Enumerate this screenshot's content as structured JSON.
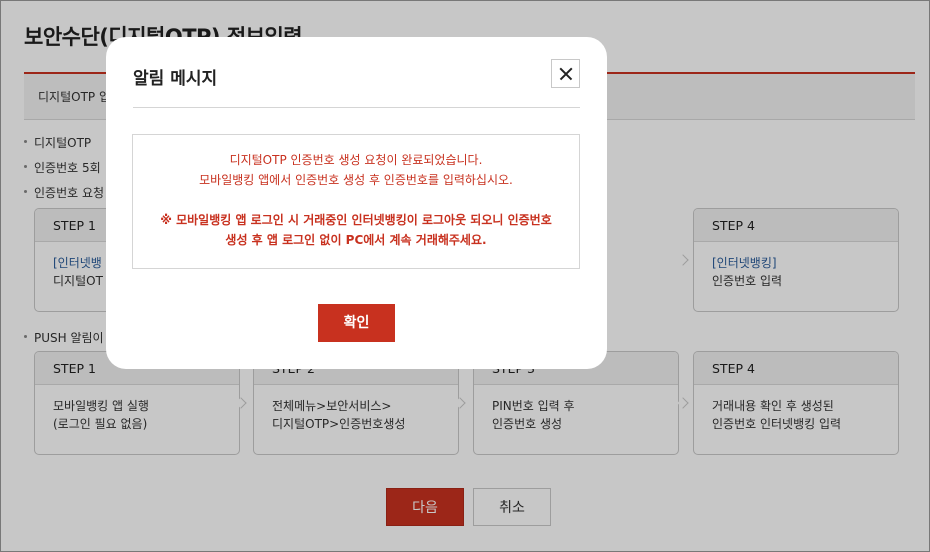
{
  "page": {
    "title": "보안수단(디지털OTP) 정보입력",
    "tab_label": "디지털OTP 입",
    "bullets": [
      "디지털OTP",
      "인증번호 5회",
      "인증번호 요청",
      "PUSH 알림이"
    ]
  },
  "steps_row1": [
    {
      "step": "STEP 1",
      "line1": "[인터넷뱅",
      "line2": "디지털OT"
    },
    {
      "step": "STEP 4",
      "line1": "[인터넷뱅킹]",
      "line2": "인증번호 입력"
    }
  ],
  "steps_row2": [
    {
      "step": "STEP 1",
      "line1": "모바일뱅킹 앱 실행",
      "line2": "(로그인 필요 없음)"
    },
    {
      "step": "STEP 2",
      "line1": "전체메뉴>보안서비스>",
      "line2": "디지털OTP>인증번호생성"
    },
    {
      "step": "STEP 3",
      "line1": "PIN번호 입력 후",
      "line2": "인증번호 생성"
    },
    {
      "step": "STEP 4",
      "line1": "거래내용 확인 후 생성된",
      "line2": "인증번호 인터넷뱅킹 입력"
    }
  ],
  "buttons": {
    "next": "다음",
    "cancel": "취소"
  },
  "modal": {
    "title": "알림 메시지",
    "message_line1": "디지털OTP 인증번호 생성 요청이 완료되었습니다.",
    "message_line2": "모바일뱅킹 앱에서 인증번호 생성 후 인증번호를 입력하십시오.",
    "warning_line1": "※ 모바일뱅킹 앱 로그인 시 거래중인 인터넷뱅킹이 로그아웃 되오니 인증번호",
    "warning_line2": "생성 후 앱 로그인 없이 PC에서 계속 거래해주세요.",
    "ok_label": "확인"
  },
  "colors": {
    "accent": "#c8311f",
    "link_blue": "#2a5c9a"
  }
}
